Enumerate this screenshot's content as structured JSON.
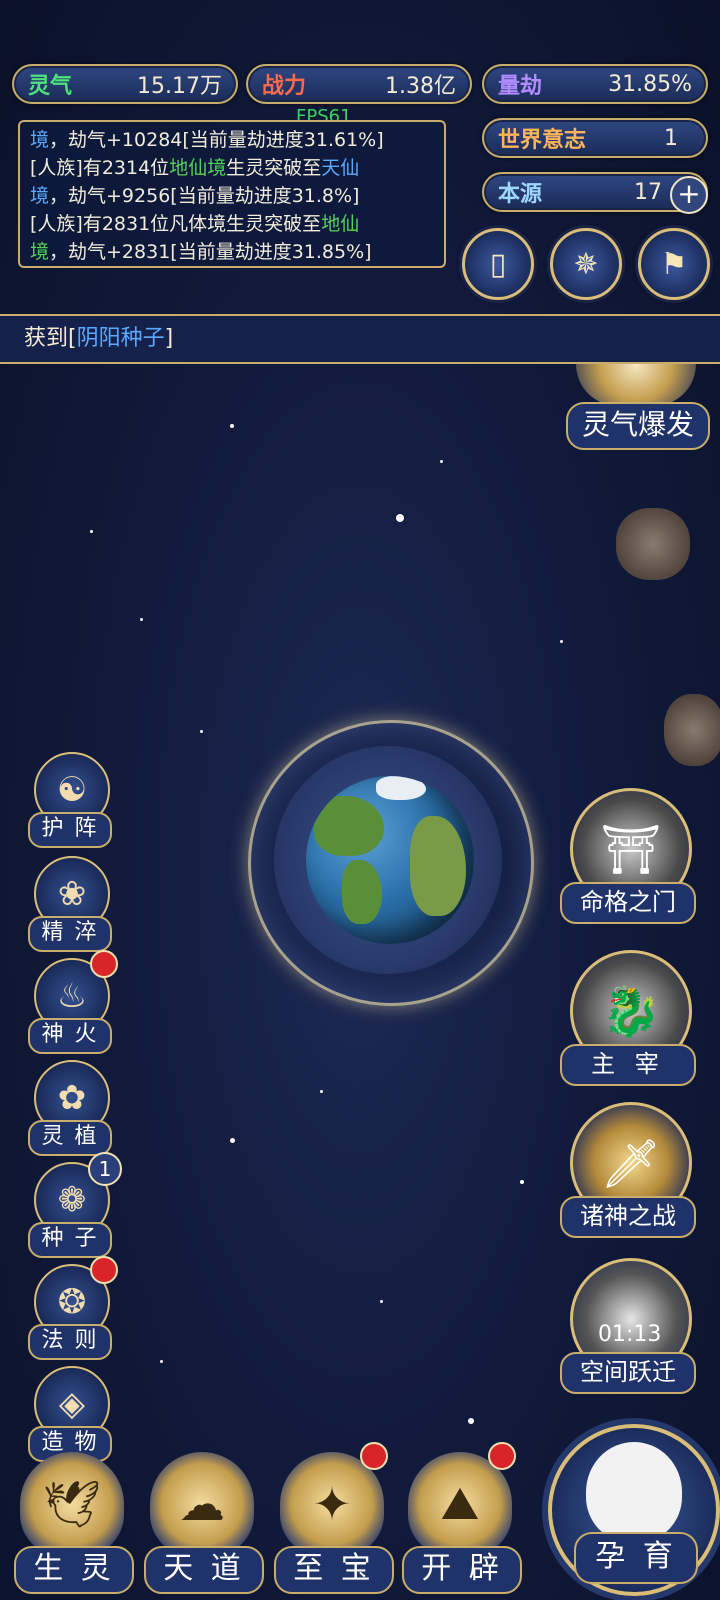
{
  "stats": {
    "lingqi": {
      "label": "灵气",
      "value": "15.17万",
      "color": "#4ee27a"
    },
    "zhanli": {
      "label": "战力",
      "value": "1.38亿",
      "color": "#ff6a4d"
    },
    "liangjie": {
      "label": "量劫",
      "value": "31.85%",
      "color": "#b28bff"
    },
    "shijie": {
      "label": "世界意志",
      "value": "1",
      "color": "#ffb45a"
    },
    "benyuan": {
      "label": "本源",
      "value": "17",
      "color": "#9fd8ff"
    }
  },
  "fps": "FPS61",
  "log": {
    "line1_prefix": "境",
    "line1_rest": "，劫气+10284[当前量劫进度31.61%]",
    "line2_a": "[人族]有2314位",
    "line2_b": "地仙境",
    "line2_c": "生灵突破至",
    "line2_d": "天仙",
    "line3_a": "境",
    "line3_b": "，劫气+9256[当前量劫进度31.8%]",
    "line4_a": "[人族]有2831位凡体境生灵突破至",
    "line4_b": "地仙",
    "line5_a": "境",
    "line5_b": "，劫气+2831[当前量劫进度31.85%]"
  },
  "banner": {
    "prefix": "获到[",
    "link": "阴阳种子",
    "suffix": "]"
  },
  "left_buttons": [
    {
      "label": "护 阵",
      "icon": "☯"
    },
    {
      "label": "精 淬",
      "icon": "❀"
    },
    {
      "label": "神 火",
      "icon": "♨"
    },
    {
      "label": "灵 植",
      "icon": "✿"
    },
    {
      "label": "种 子",
      "icon": "❁",
      "badge": "1"
    },
    {
      "label": "法 则",
      "icon": "❂"
    },
    {
      "label": "造 物",
      "icon": "◈"
    }
  ],
  "right_buttons": {
    "burst": "灵气爆发",
    "mingge": "命格之门",
    "zhuzai": "主 宰",
    "zhushen": "诸神之战",
    "kongjian": "空间跃迁",
    "timer": "01:13"
  },
  "bottom_buttons": [
    "生 灵",
    "天 道",
    "至 宝",
    "开 辟"
  ],
  "big_button": "孕 育"
}
